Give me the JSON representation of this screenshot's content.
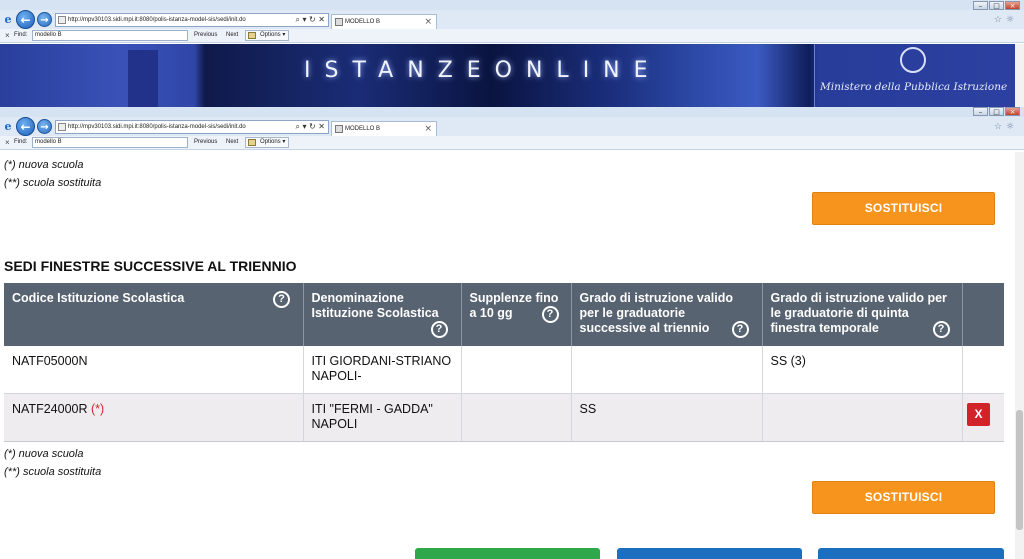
{
  "browser_back": {
    "url": "http://mpv30103.sidi.mpi.it:8080/polis-istanza-model-sis/sedi/init.do",
    "tab_title": "MODELLO B",
    "find_label": "Find:",
    "find_value": "modello B",
    "find_prev": "Previous",
    "find_next": "Next",
    "find_options": "Options"
  },
  "browser_front": {
    "url": "http://mpv30103.sidi.mpi.it:8080/polis-istanza-model-sis/sedi/init.do",
    "tab_title": "MODELLO B",
    "find_label": "Find:",
    "find_value": "modello B",
    "find_prev": "Previous",
    "find_next": "Next",
    "find_options": "Options"
  },
  "banner": {
    "brand": "ISTANZEONLINE",
    "ministry": "Ministero della Pubblica Istruzione"
  },
  "legend_top": {
    "new_school": "(*) nuova scuola",
    "replaced_school": "(**) scuola sostituita"
  },
  "replace_button_label": "SOSTITUISCI",
  "section_title": "SEDI FINESTRE SUCCESSIVE AL TRIENNIO",
  "table": {
    "headers": [
      "Codice Istituzione Scolastica",
      "Denominazione Istituzione Scolastica",
      "Supplenze fino a 10 gg",
      "Grado di istruzione valido per le graduatorie successive al triennio",
      "Grado di istruzione valido per le graduatorie di quinta finestra temporale",
      ""
    ],
    "help_glyph": "?",
    "rows": [
      {
        "code": "NATF05000N",
        "marker": "",
        "name": "ITI GIORDANI-STRIANO NAPOLI-",
        "supplenze": "",
        "grado_triennio": "",
        "grado_quinta": "SS (3)"
      },
      {
        "code": "NATF24000R",
        "marker": "(*)",
        "name": "ITI \"FERMI - GADDA\" NAPOLI",
        "supplenze": "",
        "grado_triennio": "SS",
        "grado_quinta": ""
      }
    ],
    "delete_label": "X"
  },
  "legend_bottom": {
    "new_school": "(*) nuova scuola",
    "replaced_school": "(**) scuola sostituita"
  },
  "colors": {
    "orange": "#f7941d",
    "header": "#586371",
    "green": "#3e9b3a",
    "red": "#d2232a",
    "bottom_green": "#2ea84a",
    "bottom_blue": "#1c6fbf"
  }
}
